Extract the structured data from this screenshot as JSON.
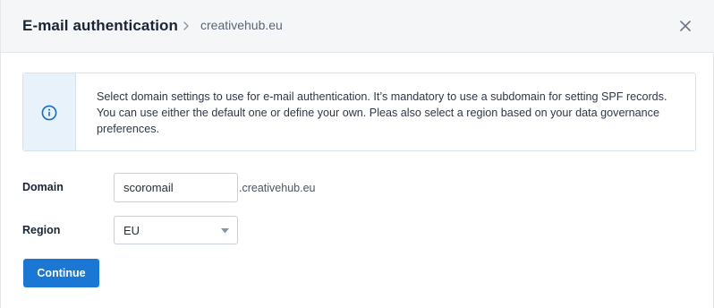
{
  "header": {
    "title": "E-mail authentication",
    "breadcrumb": "creativehub.eu"
  },
  "info": {
    "text": "Select domain settings to use for e-mail authentication. It’s mandatory to use a subdomain for setting SPF records. You can use either the default one or define your own. Pleas also select a region based on your data governance preferences."
  },
  "form": {
    "domain_label": "Domain",
    "domain_value": "scoromail",
    "domain_suffix": ".creativehub.eu",
    "region_label": "Region",
    "region_value": "EU"
  },
  "actions": {
    "continue_label": "Continue"
  },
  "colors": {
    "primary": "#1a78d4",
    "info_accent": "#1a6fc0",
    "header_bg": "#f5f6f8"
  }
}
